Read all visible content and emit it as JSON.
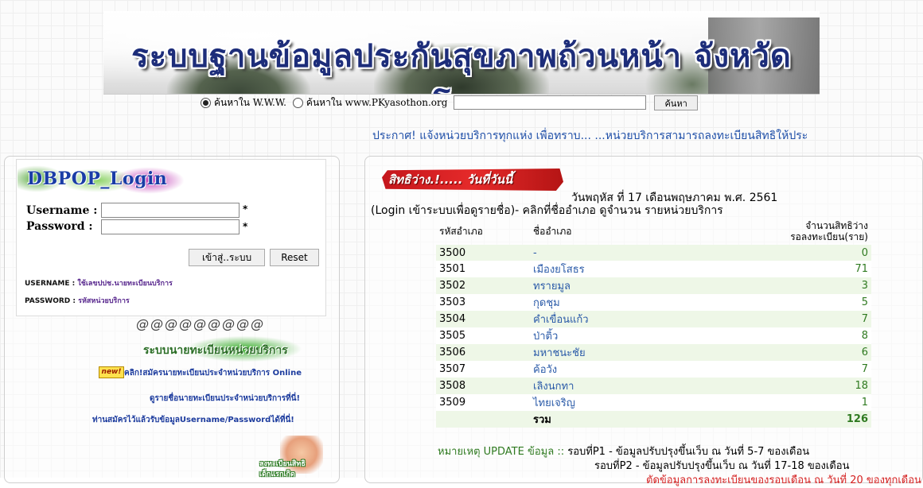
{
  "banner": {
    "title": "ระบบฐานข้อมูลประกันสุขภาพถ้วนหน้า จังหวัดยโสธร"
  },
  "search": {
    "option_www": "ค้นหาใน W.W.W.",
    "option_site": "ค้นหาใน www.PKyasothon.org",
    "selected": "www",
    "query": "",
    "button_label": "ค้นหา"
  },
  "announcement": "ประกาศ! แจ้งหน่วยบริการทุกแห่ง เพื่อทราบ... ...หน่วยบริการสามารถลงทะเบียนสิทธิให้ประ",
  "login": {
    "logo_text": "DBPOP_Login",
    "username_label": "Username :",
    "password_label": "Password :",
    "username_value": "",
    "password_value": "",
    "required_mark": "*",
    "submit_label": "เข้าสู่..ระบบ",
    "reset_label": "Reset",
    "username_hint_key": "USERNAME :",
    "username_hint_value": "ใช้เลขปปช.นายทะเบียนบริการ",
    "password_hint_key": "PASSWORD :",
    "password_hint_value": "รหัสหน่วยบริการ"
  },
  "sidebar": {
    "at_row": "@@@@@@@@@",
    "register_banner": "ระบบนายทะเบียนหน่วยบริการ",
    "new_badge": "new!",
    "links": [
      "คลิก!สมัครนายทะเบียนประจำหน่วยบริการ Online",
      "ดูรายชื่อนายทะเบียนประจำหน่วยบริการที่นี่!",
      "ท่านสมัครไว้แล้วรับข้อมูลUsername/Passwordได้ที่นี่!"
    ],
    "baby_caption_1": "ลงทะเบียนสิทธิ",
    "baby_caption_2": "เด็กแรกเกิด"
  },
  "vacancy": {
    "badge": "สิทธิว่าง.!..... วันที่วันนี้",
    "date_line": "วันพฤหัส ที่ 17 เดือนพฤษภาคม พ.ศ. 2561",
    "instruction": "(Login เข้าระบบเพื่อดูรายชื่อ)- คลิกที่ชื่ออำเภอ ดูจำนวน รายหน่วยบริการ",
    "headers": {
      "code": "รหัสอำเภอ",
      "name": "ชื่ออำเภอ",
      "count_1": "จำนวนสิทธิว่าง",
      "count_2": "รอลงทะเบียน(ราย)"
    },
    "rows": [
      {
        "code": "3500",
        "name": "-",
        "count": "0"
      },
      {
        "code": "3501",
        "name": "เมืองยโสธร",
        "count": "71"
      },
      {
        "code": "3502",
        "name": "ทรายมูล",
        "count": "3"
      },
      {
        "code": "3503",
        "name": "กุดชุม",
        "count": "5"
      },
      {
        "code": "3504",
        "name": "คำเขื่อนแก้ว",
        "count": "7"
      },
      {
        "code": "3505",
        "name": "ป่าติ้ว",
        "count": "8"
      },
      {
        "code": "3506",
        "name": "มหาชนะชัย",
        "count": "6"
      },
      {
        "code": "3507",
        "name": "ค้อวัง",
        "count": "7"
      },
      {
        "code": "3508",
        "name": "เลิงนกทา",
        "count": "18"
      },
      {
        "code": "3509",
        "name": "ไทยเจริญ",
        "count": "1"
      }
    ],
    "total_label": "รวม",
    "total_value": "126",
    "note_label": "หมายเหตุ UPDATE ข้อมูล ::",
    "note_round1": "รอบที่P1 - ข้อมูลปรับปรุงขึ้นเว็บ ณ วันที่ 5-7 ของเดือน",
    "note_round2": "รอบที่P2 - ข้อมูลปรับปรุงขึ้นเว็บ ณ วันที่ 17-18 ของเดือน",
    "note_round3": "ตัดข้อมูลการลงทะเบียนของรอบเดือน ณ วันที่ 20 ของทุกเดือน"
  }
}
